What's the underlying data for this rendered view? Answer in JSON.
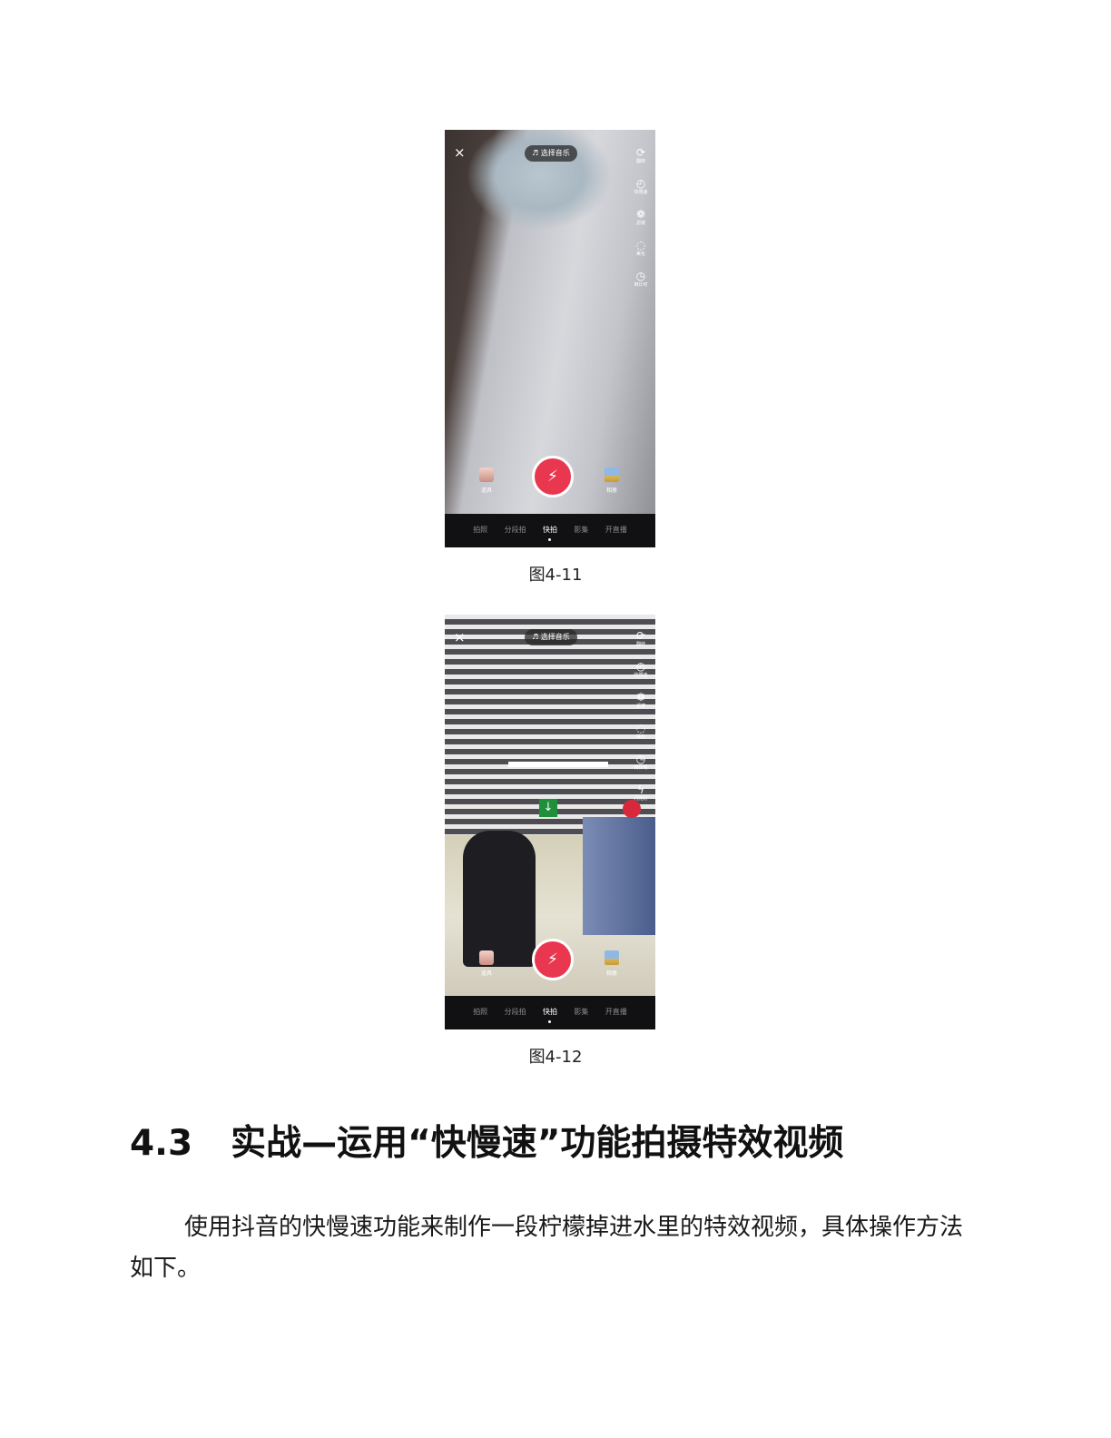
{
  "figures": [
    {
      "caption": "图4-11",
      "top_bar": {
        "close": "×",
        "music": "♬ 选择音乐"
      },
      "side_tools": [
        {
          "icon": "flip-camera-icon",
          "glyph": "⟳",
          "label": "翻转"
        },
        {
          "icon": "speed-icon",
          "glyph": "◴",
          "label": "快慢速"
        },
        {
          "icon": "filter-icon",
          "glyph": "❁",
          "label": "滤镜"
        },
        {
          "icon": "beautify-icon",
          "glyph": "◌",
          "label": "美化"
        },
        {
          "icon": "timer-icon",
          "glyph": "◷",
          "label": "倒计时"
        }
      ],
      "left_button": "道具",
      "right_button": "相册",
      "shutter_glyph": "⚡",
      "modes": [
        "拍照",
        "分段拍",
        "快拍",
        "影集",
        "开直播"
      ],
      "active_mode": "快拍"
    },
    {
      "caption": "图4-12",
      "top_bar": {
        "close": "×",
        "music": "♬ 选择音乐"
      },
      "side_tools": [
        {
          "icon": "flip-camera-icon",
          "glyph": "⟳",
          "label": "翻转"
        },
        {
          "icon": "speed-icon",
          "glyph": "◴",
          "label": "快慢速"
        },
        {
          "icon": "filter-icon",
          "glyph": "❁",
          "label": "滤镜"
        },
        {
          "icon": "beautify-icon",
          "glyph": "◌",
          "label": "美化"
        },
        {
          "icon": "timer-icon",
          "glyph": "◷",
          "label": "倒计时"
        },
        {
          "icon": "flash-off-icon",
          "glyph": "ϟ",
          "label": "闪光灯"
        }
      ],
      "left_button": "道具",
      "right_button": "相册",
      "shutter_glyph": "⚡",
      "modes": [
        "拍照",
        "分段拍",
        "快拍",
        "影集",
        "开直播"
      ],
      "active_mode": "快拍"
    }
  ],
  "section": {
    "number": "4.3",
    "title": "实战—运用“快慢速”功能拍摄特效视频"
  },
  "paragraph": "使用抖音的快慢速功能来制作一段柠檬掉进水里的特效视频，具体操作方法如下。"
}
